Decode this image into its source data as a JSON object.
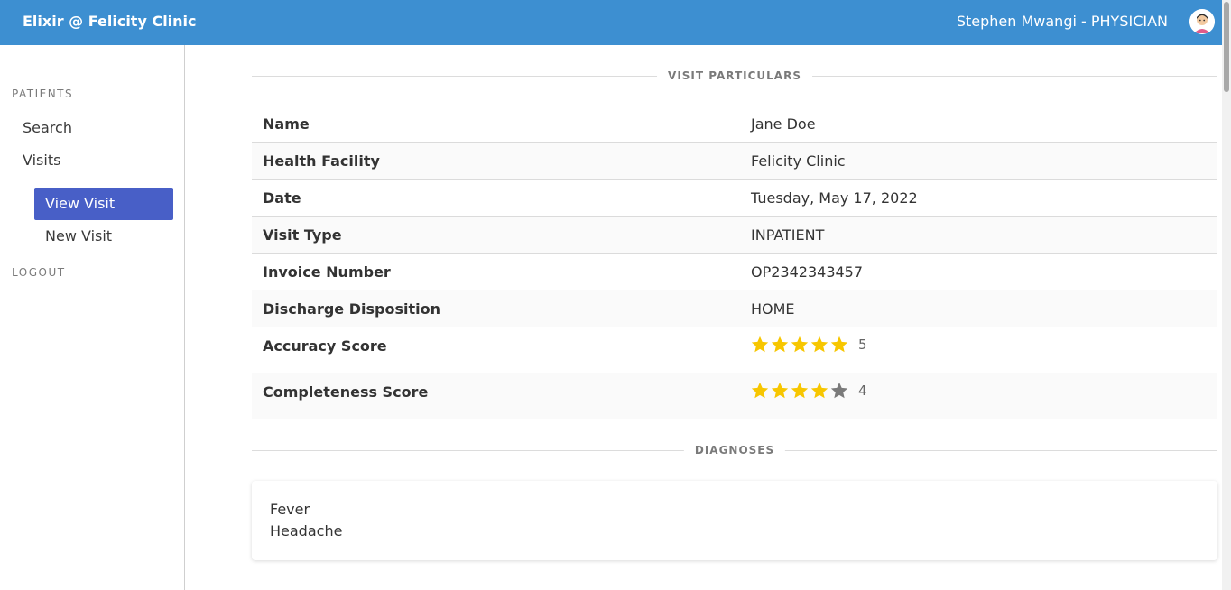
{
  "header": {
    "brand": "Elixir @ Felicity Clinic",
    "user": "Stephen Mwangi - PHYSICIAN"
  },
  "sidebar": {
    "patients_label": "PATIENTS",
    "search": "Search",
    "visits": "Visits",
    "view_visit": "View Visit",
    "new_visit": "New Visit",
    "logout": "LOGOUT"
  },
  "visit": {
    "section_title": "VISIT PARTICULARS",
    "rows": [
      {
        "label": "Name",
        "value": "Jane Doe"
      },
      {
        "label": "Health Facility",
        "value": "Felicity Clinic"
      },
      {
        "label": "Date",
        "value": "Tuesday, May 17, 2022"
      },
      {
        "label": "Visit Type",
        "value": "INPATIENT"
      },
      {
        "label": "Invoice Number",
        "value": "OP2342343457"
      },
      {
        "label": "Discharge Disposition",
        "value": "HOME"
      }
    ],
    "accuracy": {
      "label": "Accuracy Score",
      "score": 5,
      "max": 5,
      "display": "5"
    },
    "completeness": {
      "label": "Completeness Score",
      "score": 4,
      "max": 5,
      "display": "4"
    }
  },
  "diagnoses": {
    "section_title": "DIAGNOSES",
    "items": [
      "Fever",
      "Headache"
    ]
  },
  "colors": {
    "header": "#3d8fd1",
    "active": "#485fc7",
    "star_on": "#f7c600",
    "star_off": "#7a7a7a"
  }
}
